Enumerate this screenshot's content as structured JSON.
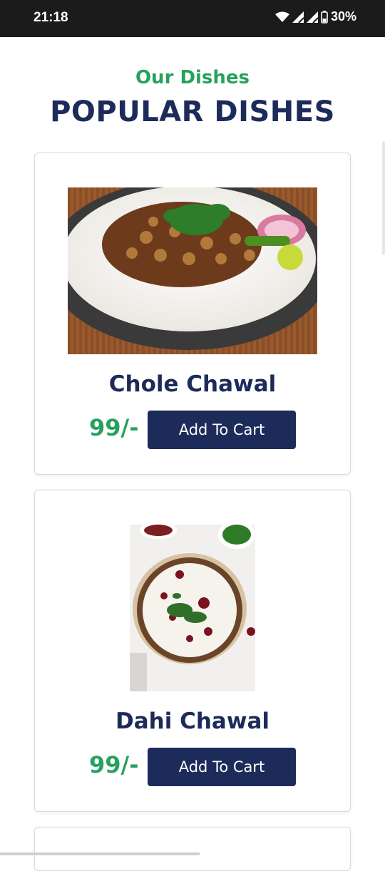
{
  "status_bar": {
    "time": "21:18",
    "battery": "30%",
    "icons": [
      "wifi-icon",
      "signal-icon",
      "signal-icon",
      "battery-icon"
    ]
  },
  "section": {
    "subtitle": "Our Dishes",
    "title": "POPULAR DISHES"
  },
  "dishes": [
    {
      "name": "Chole Chawal",
      "price": "99/-",
      "button_label": "Add To Cart",
      "image_icon": "chole-chawal-photo"
    },
    {
      "name": "Dahi Chawal",
      "price": "99/-",
      "button_label": "Add To Cart",
      "image_icon": "dahi-chawal-photo"
    }
  ],
  "colors": {
    "accent_green": "#27a15d",
    "navy": "#1c2b5a",
    "status_bar_bg": "#1b1b1b"
  }
}
